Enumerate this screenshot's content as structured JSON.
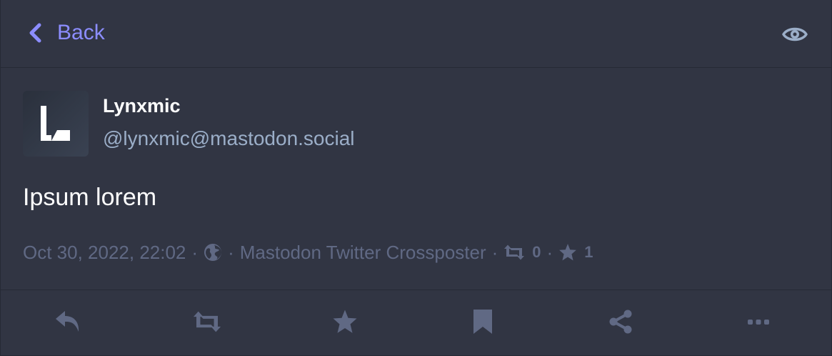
{
  "header": {
    "back_label": "Back",
    "back_icon": "chevron-left-icon",
    "visibility_icon": "eye-icon"
  },
  "status": {
    "display_name": "Lynxmic",
    "account": "@lynxmic@mastodon.social",
    "content": "Ipsum lorem",
    "timestamp": "Oct 30, 2022, 22:02",
    "visibility_icon": "globe-icon",
    "application": "Mastodon Twitter Crossposter",
    "reblogs_count": "0",
    "favourites_count": "1",
    "separator": "·"
  },
  "actions": [
    {
      "name": "reply",
      "icon": "reply-icon"
    },
    {
      "name": "boost",
      "icon": "retweet-icon"
    },
    {
      "name": "favourite",
      "icon": "star-icon"
    },
    {
      "name": "bookmark",
      "icon": "bookmark-icon"
    },
    {
      "name": "share",
      "icon": "share-icon"
    },
    {
      "name": "more",
      "icon": "ellipsis-icon"
    }
  ],
  "colors": {
    "background": "#313543",
    "accent": "#8c8dff",
    "secondary_text": "#9baec8",
    "muted_text": "#606984",
    "primary_text": "#ffffff"
  }
}
